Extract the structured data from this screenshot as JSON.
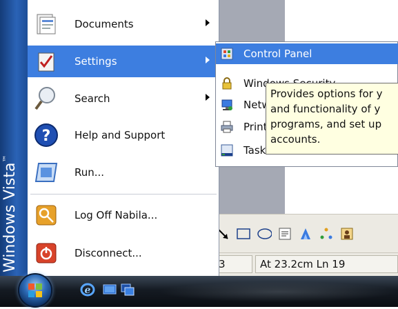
{
  "start_menu": {
    "brand": "Windows Vista",
    "brand_tm": "™",
    "items": [
      {
        "label": "Documents",
        "icon": "documents-icon",
        "has_submenu": true
      },
      {
        "label": "Settings",
        "icon": "settings-icon",
        "has_submenu": true,
        "active": true
      },
      {
        "label": "Search",
        "icon": "search-icon",
        "has_submenu": true
      },
      {
        "label": "Help and Support",
        "icon": "help-icon",
        "has_submenu": false
      },
      {
        "label": "Run...",
        "icon": "run-icon",
        "has_submenu": false
      },
      {
        "label": "Log Off Nabila...",
        "icon": "logoff-icon",
        "has_submenu": false
      },
      {
        "label": "Disconnect...",
        "icon": "disconnect-icon",
        "has_submenu": false
      }
    ]
  },
  "settings_submenu": {
    "items": [
      {
        "label": "Control Panel",
        "icon": "control-panel-icon",
        "active": true
      },
      {
        "label": "Windows Security",
        "icon": "lock-icon"
      },
      {
        "label": "Network Connections",
        "icon": "network-icon"
      },
      {
        "label": "Printers and Faxes",
        "icon": "printer-icon"
      },
      {
        "label": "Taskbar and Start Menu",
        "icon": "taskbar-icon"
      }
    ]
  },
  "tooltip": {
    "lines": [
      "Provides options for y",
      "and functionality of y",
      "programs, and set up",
      "accounts."
    ]
  },
  "status_bar": {
    "left_value": "3",
    "position": "At 23.2cm  Ln 19"
  },
  "colors": {
    "highlight": "#3d7ee0",
    "brand_strip": "#2a63b6",
    "tooltip_bg": "#ffffe1",
    "taskbar": "#151b23"
  }
}
